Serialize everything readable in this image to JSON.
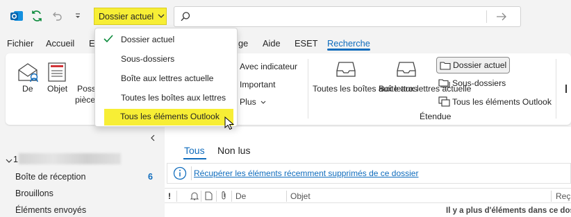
{
  "titlebar": {
    "scope_label": "Dossier actuel"
  },
  "menu": {
    "items": [
      "Fichier",
      "Accueil",
      "E",
      "ge",
      "Aide",
      "ESET",
      "Recherche"
    ]
  },
  "ribbon": {
    "de_label": "De",
    "objet_label": "Objet",
    "poss_label_1": "Poss",
    "poss_label_2": "pièce",
    "avec_indicateur": "Avec indicateur",
    "important": "Important",
    "plus": "Plus",
    "toutes_boites": "Toutes les boîtes aux lettres",
    "boite_actuelle": "Boîte aux lettres actuelle",
    "dossier_actuel": "Dossier actuel",
    "sous_dossiers": "Sous-dossiers",
    "tous_elements": "Tous les éléments Outlook",
    "etendue": "Étendue"
  },
  "dropdown": {
    "items": [
      "Dossier actuel",
      "Sous-dossiers",
      "Boîte aux lettres actuelle",
      "Toutes les boîtes aux lettres",
      "Tous les éléments Outlook"
    ]
  },
  "nav": {
    "account_prefix": "1",
    "items": [
      {
        "label": "Boîte de réception",
        "count": "6"
      },
      {
        "label": "Brouillons"
      },
      {
        "label": "Éléments envoyés"
      }
    ]
  },
  "main": {
    "tab_all": "Tous",
    "tab_unread": "Non lus",
    "info_link": "Récupérer les éléments récemment supprimés de ce dossier",
    "columns": {
      "importance": "!",
      "de": "De",
      "objet": "Objet",
      "recu": "Reçu"
    },
    "footer_text": "Il y a plus d'éléments dans ce dos"
  },
  "colors": {
    "accent": "#0f6cbd",
    "highlight": "#f7ee35"
  }
}
